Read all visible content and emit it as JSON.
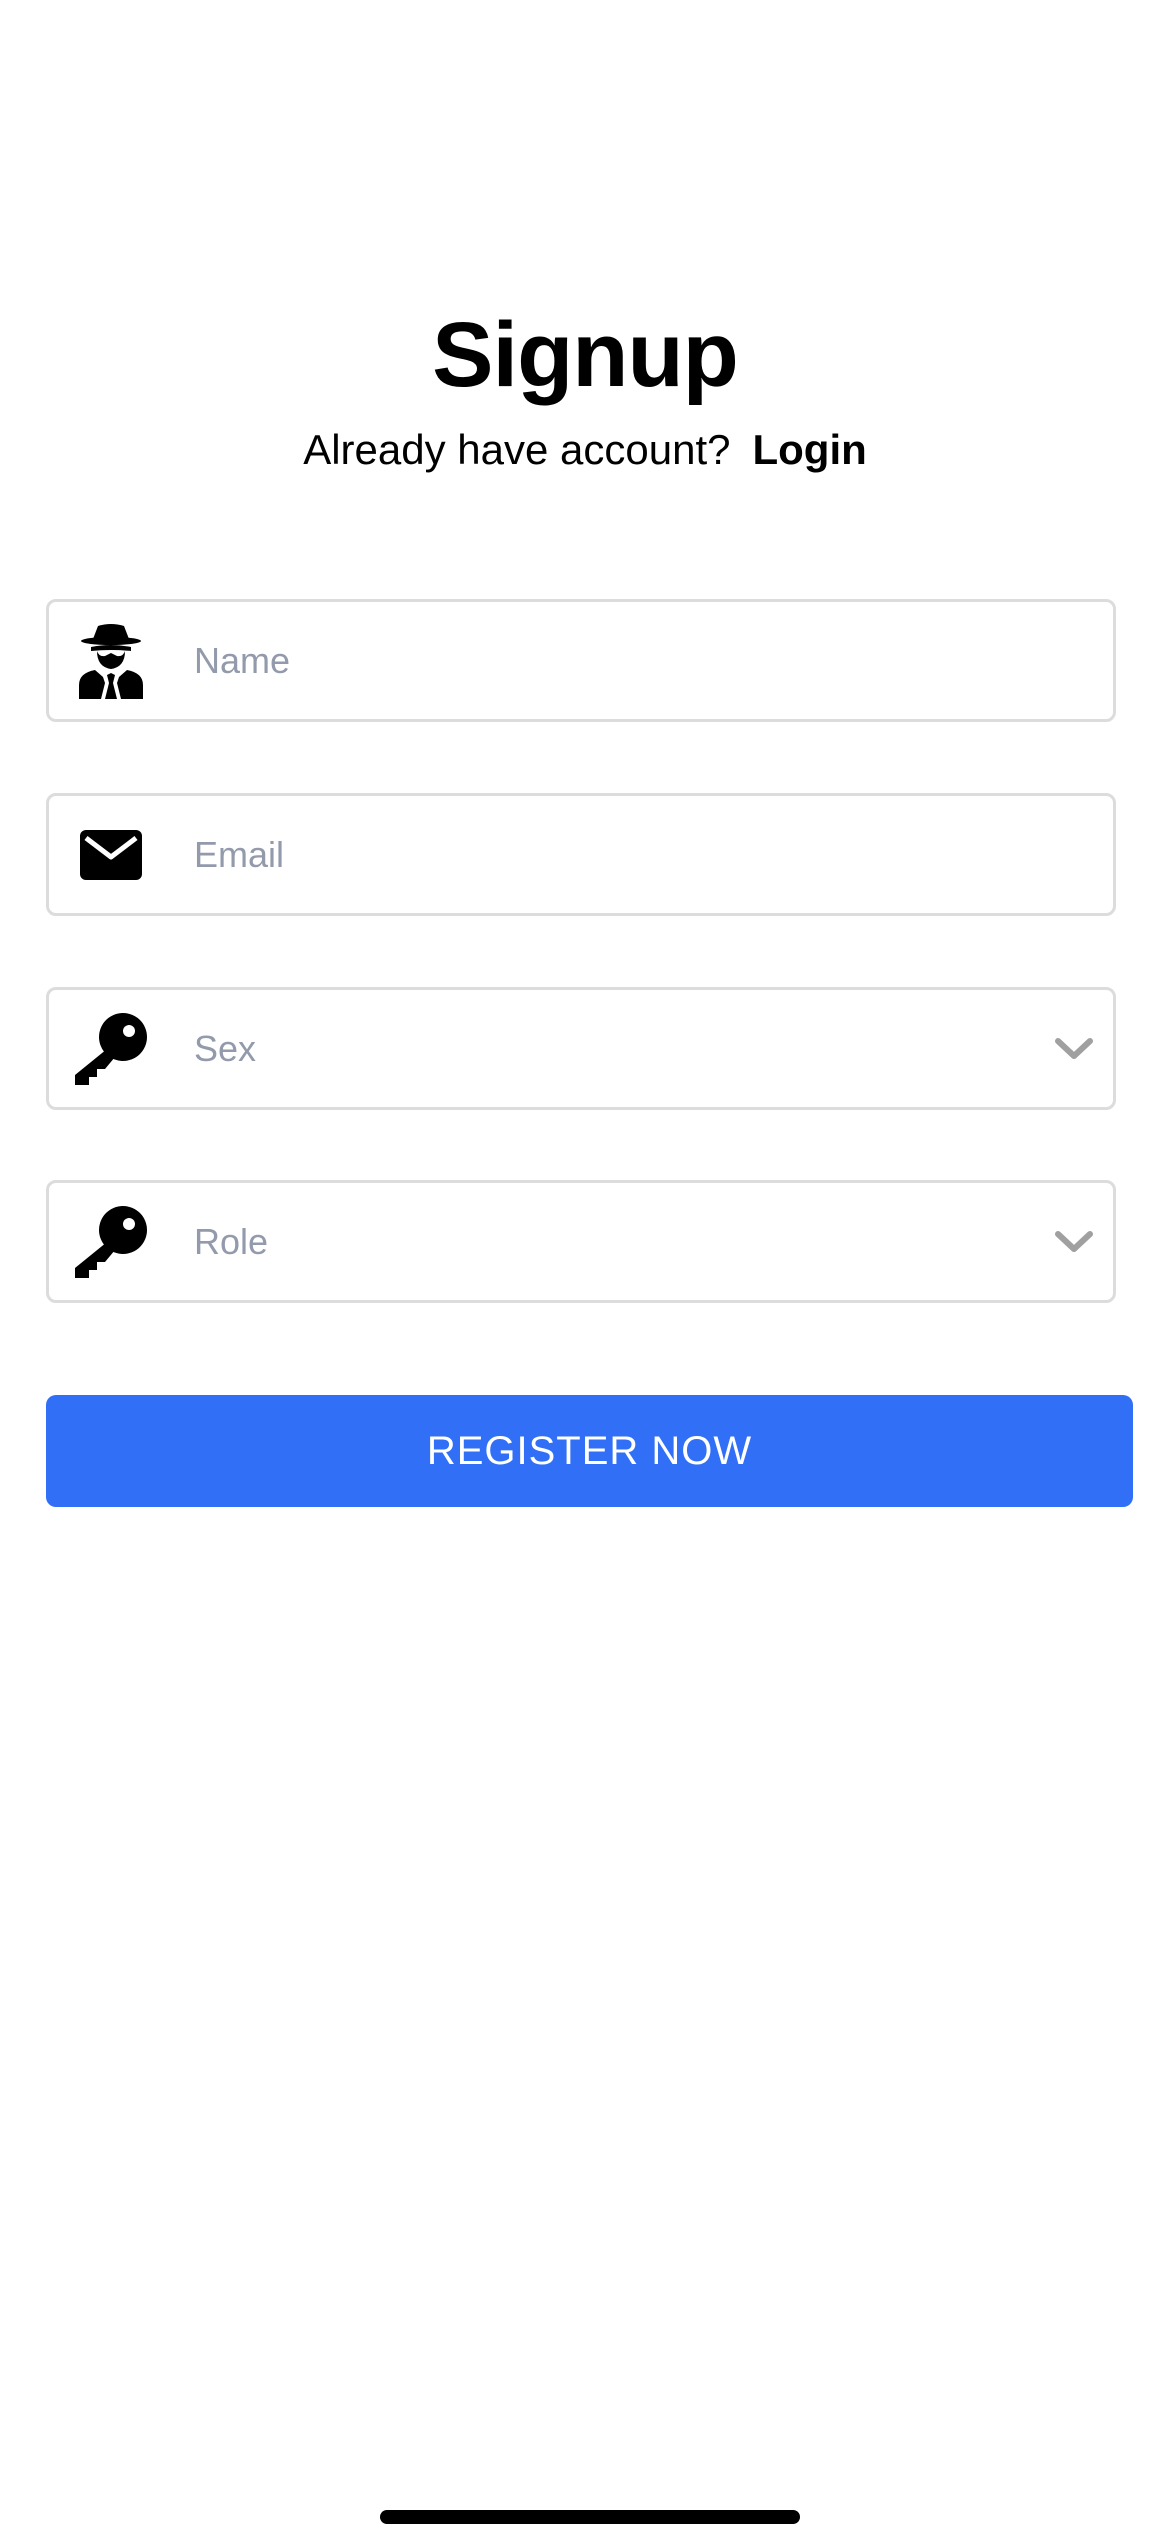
{
  "header": {
    "title": "Signup",
    "prompt_text": "Already have account?",
    "login_link": "Login"
  },
  "form": {
    "name": {
      "placeholder": "Name",
      "icon": "user-secret-icon"
    },
    "email": {
      "placeholder": "Email",
      "icon": "envelope-icon"
    },
    "sex": {
      "placeholder": "Sex",
      "icon": "key-icon",
      "dropdown_icon": "chevron-down-icon"
    },
    "role": {
      "placeholder": "Role",
      "icon": "key-icon",
      "dropdown_icon": "chevron-down-icon"
    }
  },
  "actions": {
    "register_label": "REGISTER NOW"
  },
  "colors": {
    "accent": "#316ff6",
    "field_border": "#dcdcdc",
    "placeholder": "#929aab",
    "chevron": "#a0a0a0"
  }
}
